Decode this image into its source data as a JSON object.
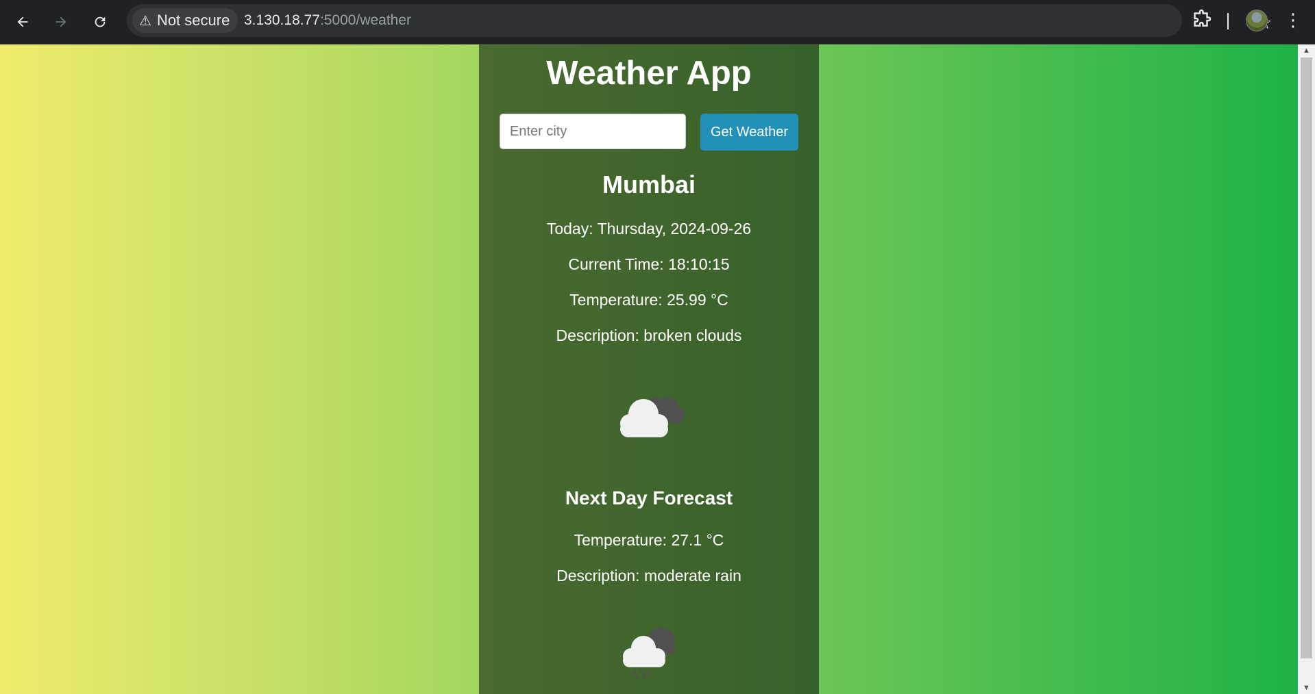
{
  "browser": {
    "security_label": "Not secure",
    "url_host": "3.130.18.77",
    "url_rest": ":5000/weather"
  },
  "app": {
    "title": "Weather App",
    "search": {
      "placeholder": "Enter city",
      "value": "",
      "button_label": "Get Weather"
    },
    "current": {
      "city": "Mumbai",
      "today": "Today: Thursday, 2024-09-26",
      "time": "Current Time: 18:10:15",
      "temperature": "Temperature: 25.99 °C",
      "description": "Description: broken clouds",
      "icon": "broken-clouds-icon"
    },
    "forecast": {
      "heading": "Next Day Forecast",
      "temperature": "Temperature: 27.1 °C",
      "description": "Description: moderate rain",
      "icon": "rain-cloud-icon"
    }
  },
  "colors": {
    "page_gradient": [
      "#efeb6e",
      "#a3d65e",
      "#6cc655",
      "#1fb247"
    ],
    "container": "#40652d",
    "button": "#2191b7"
  }
}
